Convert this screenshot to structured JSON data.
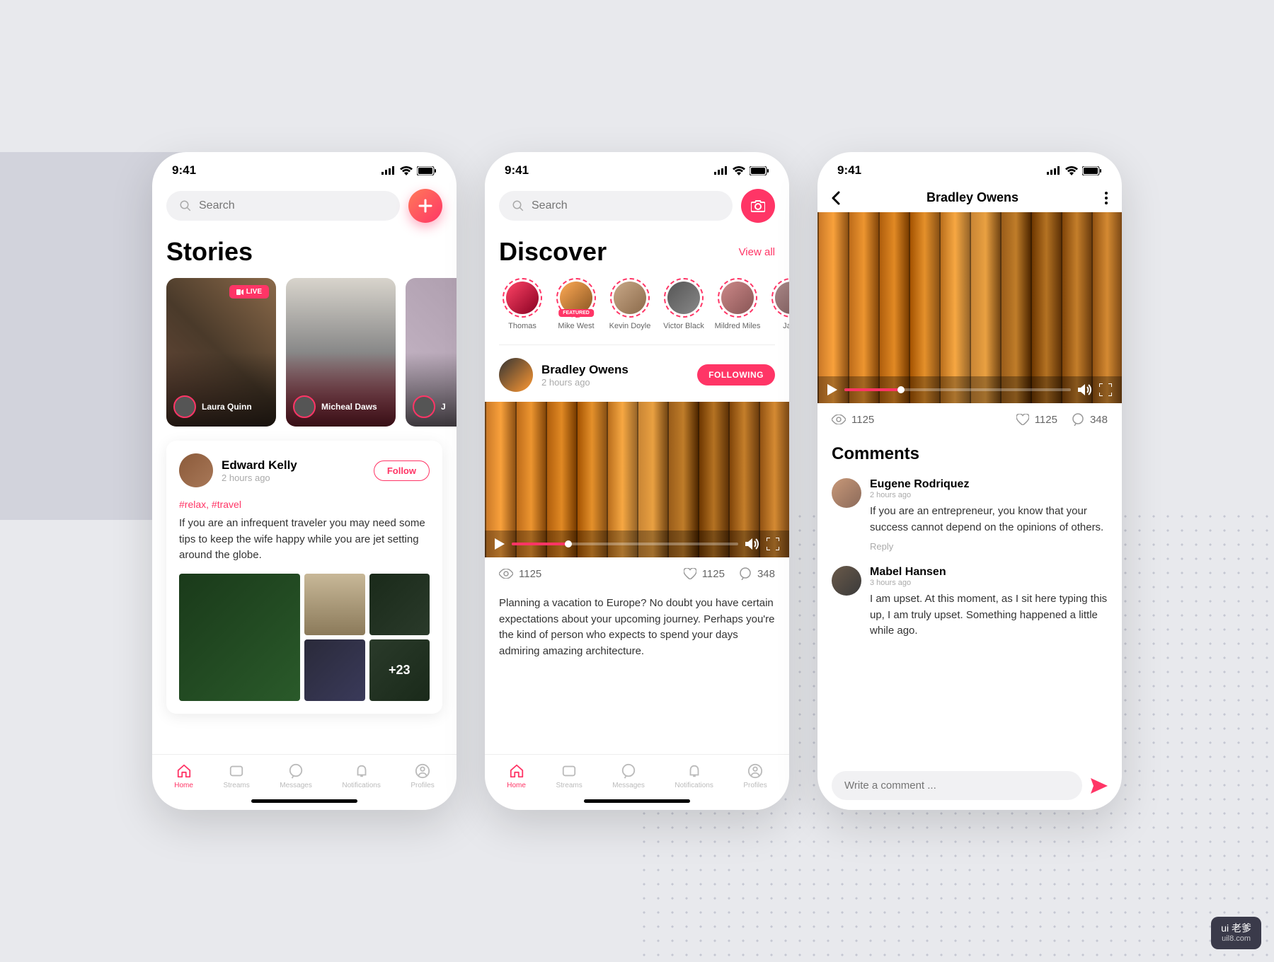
{
  "status_time": "9:41",
  "search_placeholder": "Search",
  "screen1": {
    "title": "Stories",
    "live_label": "LIVE",
    "stories": [
      {
        "name": "Laura Quinn"
      },
      {
        "name": "Micheal Daws"
      },
      {
        "name": "J"
      }
    ],
    "post": {
      "author": "Edward Kelly",
      "time": "2 hours ago",
      "follow": "Follow",
      "hashtags": "#relax, #travel",
      "text": "If you are an infrequent traveler you may need some tips to keep the wife happy while you are jet setting around the globe.",
      "more_count": "+23"
    }
  },
  "screen2": {
    "title": "Discover",
    "view_all": "View all",
    "featured_label": "FEATURED",
    "avatars": [
      {
        "name": "Thomas"
      },
      {
        "name": "Mike West"
      },
      {
        "name": "Kevin Doyle"
      },
      {
        "name": "Victor Black"
      },
      {
        "name": "Mildred Miles"
      },
      {
        "name": "Jane"
      }
    ],
    "post": {
      "author": "Bradley Owens",
      "time": "2 hours ago",
      "following": "FOLLOWING",
      "views": "1125",
      "likes": "1125",
      "comments": "348",
      "text": "Planning a vacation to Europe? No doubt you have certain expectations about your upcoming journey. Perhaps you're the kind of person who expects to spend your days admiring amazing architecture."
    }
  },
  "screen3": {
    "title": "Bradley Owens",
    "views": "1125",
    "likes": "1125",
    "comments_count": "348",
    "comments_title": "Comments",
    "comments": [
      {
        "name": "Eugene Rodriquez",
        "time": "2 hours ago",
        "text": "If you are an entrepreneur, you know that your success cannot depend on the opinions of others.",
        "reply": "Reply"
      },
      {
        "name": "Mabel Hansen",
        "time": "3 hours ago",
        "text": "I am upset. At this moment, as I sit here typing this up, I am truly upset. Something happened a little while ago."
      }
    ],
    "input_placeholder": "Write a comment ..."
  },
  "nav": {
    "home": "Home",
    "streams": "Streams",
    "messages": "Messages",
    "notifications": "Notifications",
    "profiles": "Profiles"
  },
  "watermark_top": "ui 老爹",
  "watermark_bottom": "uil8.com"
}
